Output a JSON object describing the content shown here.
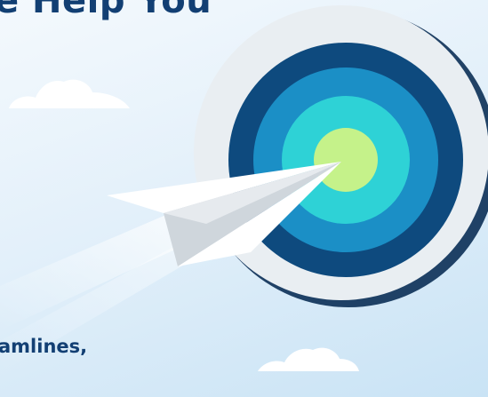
{
  "hero": {
    "headline": "e Help You",
    "subline": "amlines,"
  },
  "colors": {
    "headline": "#123f73",
    "ring_outer": "#0e4a7e",
    "ring_second": "#1b8fc6",
    "ring_third": "#2ed2d6",
    "bullseye": "#c5f28a",
    "target_backplate": "#e9eef2",
    "plane": "#ffffff"
  },
  "icons": {
    "plane": "paper-plane-icon",
    "target": "target-icon",
    "cloud": "cloud-icon"
  }
}
